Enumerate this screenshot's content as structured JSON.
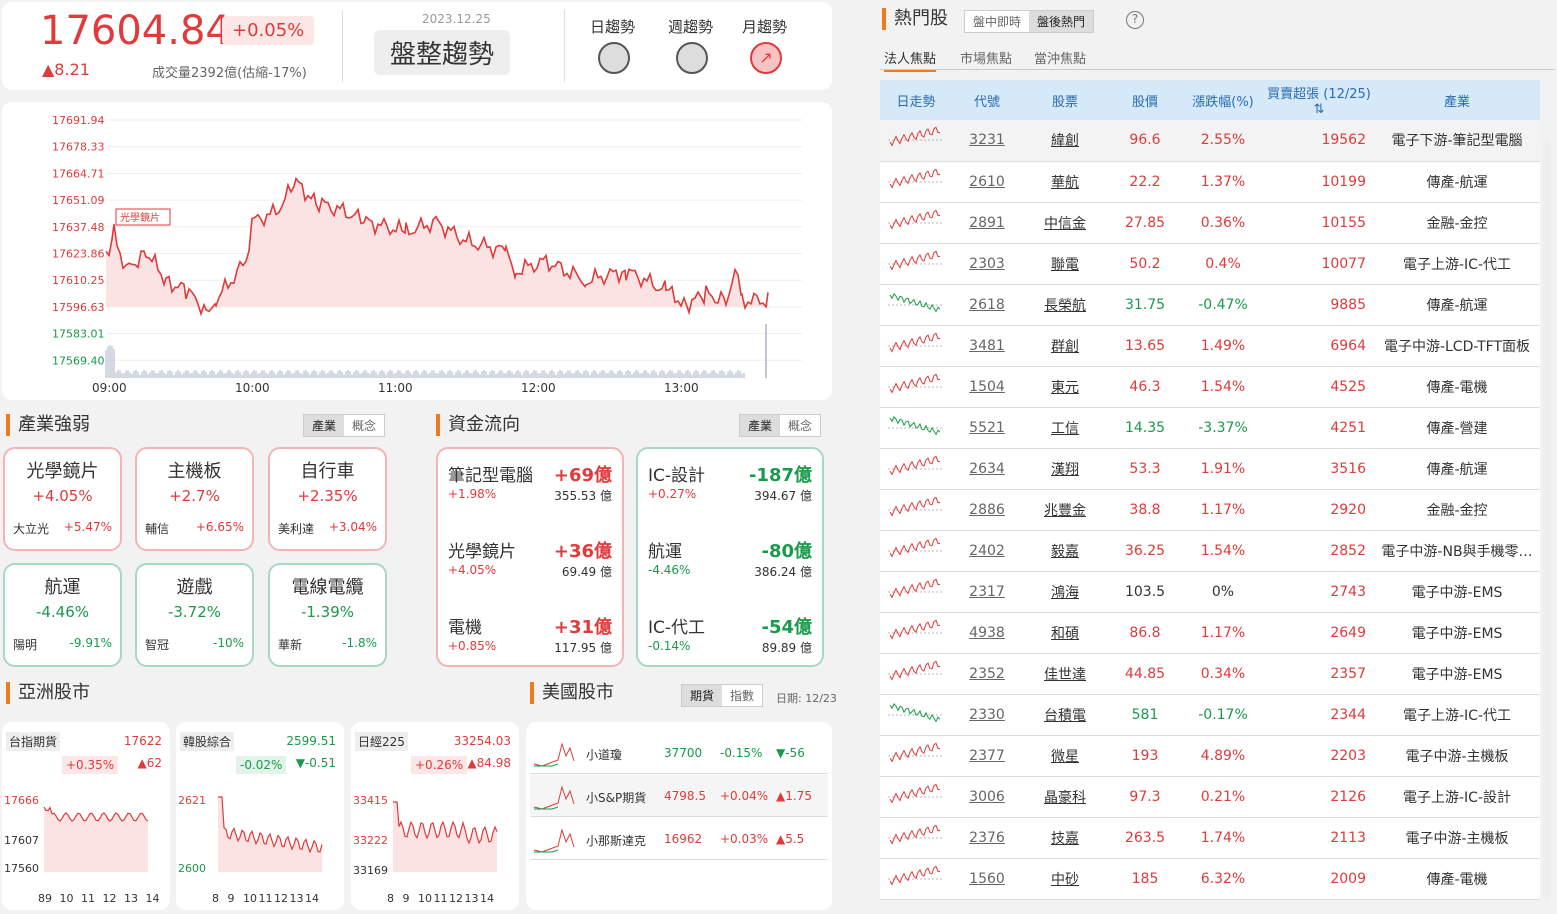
{
  "index": {
    "value": "17604.84",
    "change_pct": "+0.05%",
    "change": "▲8.21",
    "volume": "成交量2392億(估縮-17%)",
    "date": "2023.12.25",
    "trend": "盤整趨勢",
    "daily": "日趨勢",
    "weekly": "週趨勢",
    "monthly": "月趨勢"
  },
  "chart": {
    "yticks": [
      "17691.94",
      "17678.33",
      "17664.71",
      "17651.09",
      "17637.48",
      "17623.86",
      "17610.25",
      "17596.63",
      "17583.01",
      "17569.40"
    ],
    "xticks": [
      "09:00",
      "10:00",
      "11:00",
      "12:00",
      "13:00"
    ],
    "tag": "光學鏡片"
  },
  "chart_data": {
    "type": "line",
    "x": [
      "09:00",
      "10:00",
      "11:00",
      "12:00",
      "13:00"
    ],
    "values": [
      17625,
      17610,
      17650,
      17630,
      17615,
      17600,
      17602
    ],
    "ylim": [
      17569.4,
      17691.94
    ]
  },
  "industry": {
    "title": "產業強弱",
    "tab1": "產業",
    "tab2": "概念",
    "cards": [
      {
        "name": "光學鏡片",
        "pct": "+4.05%",
        "stock": "大立光",
        "spct": "+5.47%"
      },
      {
        "name": "主機板",
        "pct": "+2.7%",
        "stock": "輔信",
        "spct": "+6.65%"
      },
      {
        "name": "自行車",
        "pct": "+2.35%",
        "stock": "美利達",
        "spct": "+3.04%"
      },
      {
        "name": "航運",
        "pct": "-4.46%",
        "stock": "陽明",
        "spct": "-9.91%"
      },
      {
        "name": "遊戲",
        "pct": "-3.72%",
        "stock": "智冠",
        "spct": "-10%"
      },
      {
        "name": "電線電纜",
        "pct": "-1.39%",
        "stock": "華新",
        "spct": "-1.8%"
      }
    ]
  },
  "flow": {
    "title": "資金流向",
    "tab1": "產業",
    "tab2": "概念",
    "in": [
      {
        "name": "筆記型電腦",
        "val": "+69億",
        "pct": "+1.98%",
        "amt": "355.53 億"
      },
      {
        "name": "光學鏡片",
        "val": "+36億",
        "pct": "+4.05%",
        "amt": "69.49 億"
      },
      {
        "name": "電機",
        "val": "+31億",
        "pct": "+0.85%",
        "amt": "117.95 億"
      }
    ],
    "out": [
      {
        "name": "IC-設計",
        "val": "-187億",
        "pct": "+0.27%",
        "amt": "394.67 億"
      },
      {
        "name": "航運",
        "val": "-80億",
        "pct": "-4.46%",
        "amt": "386.24 億"
      },
      {
        "name": "IC-代工",
        "val": "-54億",
        "pct": "-0.14%",
        "amt": "89.89 億"
      }
    ]
  },
  "asia": {
    "title": "亞洲股市",
    "markets": [
      {
        "name": "台指期貨",
        "price": "17622",
        "pct": "+0.35%",
        "chg": "▲62",
        "y1": "17666",
        "y2": "17607",
        "y3": "17560",
        "x": [
          "89",
          "10",
          "11",
          "12",
          "13",
          "14"
        ]
      },
      {
        "name": "韓股綜合",
        "price": "2599.51",
        "pct": "-0.02%",
        "chg": "▼-0.51",
        "y1": "2621",
        "y2": "",
        "y3": "2600",
        "x": [
          "8",
          "9",
          "10",
          "11",
          "12",
          "13",
          "14"
        ]
      },
      {
        "name": "日經225",
        "price": "33254.03",
        "pct": "+0.26%",
        "chg": "▲84.98",
        "y1": "33415",
        "y2": "33222",
        "y3": "33169",
        "x": [
          "8",
          "9",
          "10",
          "11",
          "12",
          "13",
          "14"
        ]
      }
    ]
  },
  "us": {
    "title": "美國股市",
    "tab1": "期貨",
    "tab2": "指數",
    "date": "日期: 12/23",
    "rows": [
      {
        "name": "小道瓊",
        "price": "37700",
        "pct": "-0.15%",
        "chg": "▼-56"
      },
      {
        "name": "小S&P期貨",
        "price": "4798.5",
        "pct": "+0.04%",
        "chg": "▲1.75"
      },
      {
        "name": "小那斯達克",
        "price": "16962",
        "pct": "+0.03%",
        "chg": "▲5.5"
      }
    ]
  },
  "hot": {
    "title": "熱門股",
    "tab1": "盤中即時",
    "tab2": "盤後熱門",
    "sub1": "法人焦點",
    "sub2": "市場焦點",
    "sub3": "當沖焦點",
    "headers": [
      "日走勢",
      "代號",
      "股票",
      "股價",
      "漲跌幅(%)",
      "買賣超張(12/25)",
      "產業"
    ],
    "rows": [
      [
        "3231",
        "緯創",
        "96.6",
        "2.55%",
        "19562",
        "電子下游-筆記型電腦",
        "up"
      ],
      [
        "2610",
        "華航",
        "22.2",
        "1.37%",
        "10199",
        "傳產-航運",
        "up"
      ],
      [
        "2891",
        "中信金",
        "27.85",
        "0.36%",
        "10155",
        "金融-金控",
        "up"
      ],
      [
        "2303",
        "聯電",
        "50.2",
        "0.4%",
        "10077",
        "電子上游-IC-代工",
        "up"
      ],
      [
        "2618",
        "長榮航",
        "31.75",
        "-0.47%",
        "9885",
        "傳產-航運",
        "dn"
      ],
      [
        "3481",
        "群創",
        "13.65",
        "1.49%",
        "6964",
        "電子中游-LCD-TFT面板",
        "up"
      ],
      [
        "1504",
        "東元",
        "46.3",
        "1.54%",
        "4525",
        "傳產-電機",
        "up"
      ],
      [
        "5521",
        "工信",
        "14.35",
        "-3.37%",
        "4251",
        "傳產-營建",
        "dn"
      ],
      [
        "2634",
        "漢翔",
        "53.3",
        "1.91%",
        "3516",
        "傳產-航運",
        "up"
      ],
      [
        "2886",
        "兆豐金",
        "38.8",
        "1.17%",
        "2920",
        "金融-金控",
        "up"
      ],
      [
        "2402",
        "毅嘉",
        "36.25",
        "1.54%",
        "2852",
        "電子中游-NB與手機零…",
        "up"
      ],
      [
        "2317",
        "鴻海",
        "103.5",
        "0%",
        "2743",
        "電子中游-EMS",
        "flat"
      ],
      [
        "4938",
        "和碩",
        "86.8",
        "1.17%",
        "2649",
        "電子中游-EMS",
        "up"
      ],
      [
        "2352",
        "佳世達",
        "44.85",
        "0.34%",
        "2357",
        "電子中游-EMS",
        "up"
      ],
      [
        "2330",
        "台積電",
        "581",
        "-0.17%",
        "2344",
        "電子上游-IC-代工",
        "dn"
      ],
      [
        "2377",
        "微星",
        "193",
        "4.89%",
        "2203",
        "電子中游-主機板",
        "up"
      ],
      [
        "3006",
        "晶豪科",
        "97.3",
        "0.21%",
        "2126",
        "電子上游-IC-設計",
        "up"
      ],
      [
        "2376",
        "技嘉",
        "263.5",
        "1.74%",
        "2113",
        "電子中游-主機板",
        "up"
      ],
      [
        "1560",
        "中砂",
        "185",
        "6.32%",
        "2009",
        "傳產-電機",
        "up"
      ]
    ]
  }
}
